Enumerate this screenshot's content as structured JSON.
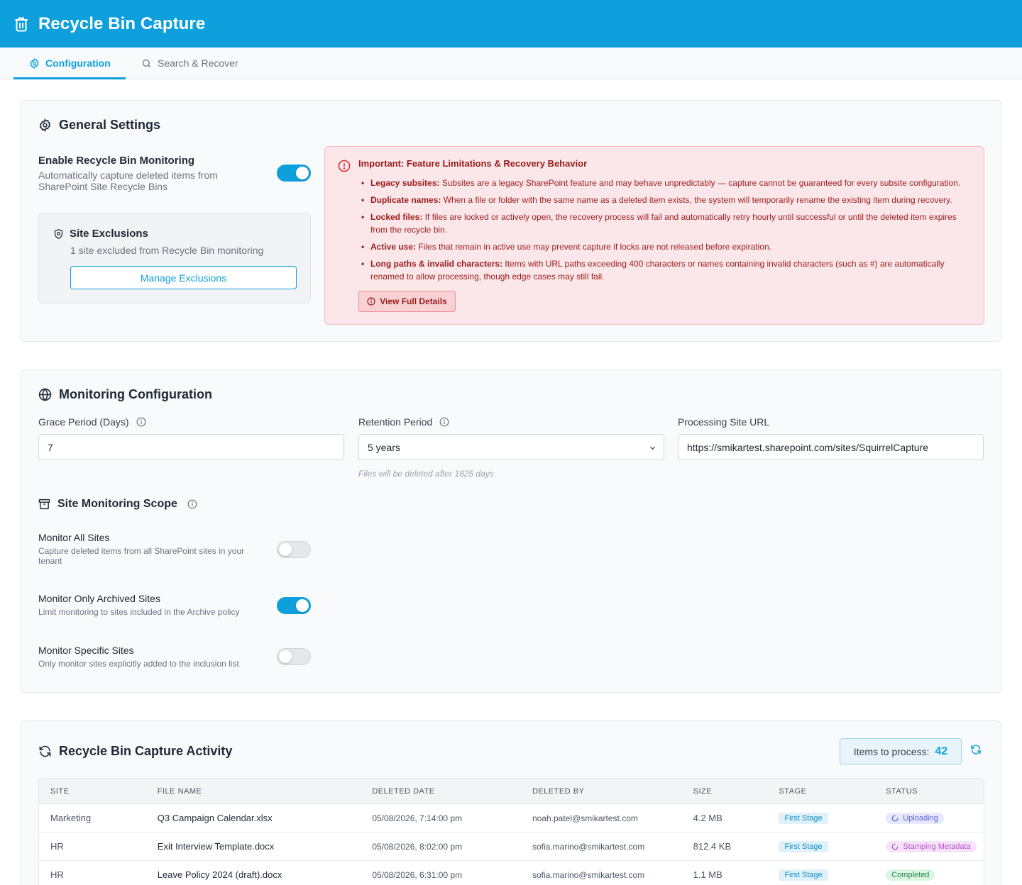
{
  "app": {
    "title": "Recycle Bin Capture"
  },
  "tabs": [
    {
      "label": "Configuration",
      "active": true
    },
    {
      "label": "Search & Recover",
      "active": false
    }
  ],
  "general": {
    "title": "General Settings",
    "enable": {
      "title": "Enable Recycle Bin Monitoring",
      "description": "Automatically capture deleted items from SharePoint Site Recycle Bins",
      "enabled": true
    },
    "exclusions": {
      "title": "Site Exclusions",
      "description": "1 site excluded from Recycle Bin monitoring",
      "button": "Manage Exclusions"
    },
    "alert": {
      "title": "Important: Feature Limitations & Recovery Behavior",
      "items": [
        {
          "label": "Legacy subsites:",
          "text": " Subsites are a legacy SharePoint feature and may behave unpredictably — capture cannot be guaranteed for every subsite configuration."
        },
        {
          "label": "Duplicate names:",
          "text": " When a file or folder with the same name as a deleted item exists, the system will temporarily rename the existing item during recovery."
        },
        {
          "label": "Locked files:",
          "text": " If files are locked or actively open, the recovery process will fail and automatically retry hourly until successful or until the deleted item expires from the recycle bin."
        },
        {
          "label": "Active use:",
          "text": " Files that remain in active use may prevent capture if locks are not released before expiration."
        },
        {
          "label": "Long paths & invalid characters:",
          "text": " Items with URL paths exceeding 400 characters or names containing invalid characters (such as #) are automatically renamed to allow processing, though edge cases may still fail."
        }
      ],
      "button": "View Full Details"
    }
  },
  "monitoring": {
    "title": "Monitoring Configuration",
    "grace": {
      "label": "Grace Period (Days)",
      "value": "7"
    },
    "retention": {
      "label": "Retention Period",
      "value": "5 years",
      "hint": "Files will be deleted after 1825 days"
    },
    "url": {
      "label": "Processing Site URL",
      "value": "https://smikartest.sharepoint.com/sites/SquirrelCapture"
    },
    "scope": {
      "title": "Site Monitoring Scope",
      "options": [
        {
          "title": "Monitor All Sites",
          "description": "Capture deleted items from all SharePoint sites in your tenant",
          "enabled": false
        },
        {
          "title": "Monitor Only Archived Sites",
          "description": "Limit monitoring to sites included in the Archive policy",
          "enabled": true
        },
        {
          "title": "Monitor Specific Sites",
          "description": "Only monitor sites explicitly added to the inclusion list",
          "enabled": false
        }
      ]
    }
  },
  "activity": {
    "title": "Recycle Bin Capture Activity",
    "counter_label": "Items to process:",
    "counter_value": "42",
    "columns": [
      "SITE",
      "FILE NAME",
      "DELETED DATE",
      "DELETED BY",
      "SIZE",
      "STAGE",
      "STATUS"
    ],
    "rows": [
      {
        "site": "Marketing",
        "file": "Q3 Campaign Calendar.xlsx",
        "date": "05/08/2026, 7:14:00 pm",
        "by": "noah.patel@smikartest.com",
        "size": "4.2 MB",
        "stage": "First Stage",
        "status": "Uploading",
        "status_kind": "up"
      },
      {
        "site": "HR",
        "file": "Exit Interview Template.docx",
        "date": "05/08/2026, 8:02:00 pm",
        "by": "sofia.marino@smikartest.com",
        "size": "812.4 KB",
        "stage": "First Stage",
        "status": "Stamping Metadata",
        "status_kind": "meta"
      },
      {
        "site": "HR",
        "file": "Leave Policy 2024 (draft).docx",
        "date": "05/08/2026, 6:31:00 pm",
        "by": "sofia.marino@smikartest.com",
        "size": "1.1 MB",
        "stage": "First Stage",
        "status": "Completed",
        "status_kind": "done"
      }
    ]
  }
}
